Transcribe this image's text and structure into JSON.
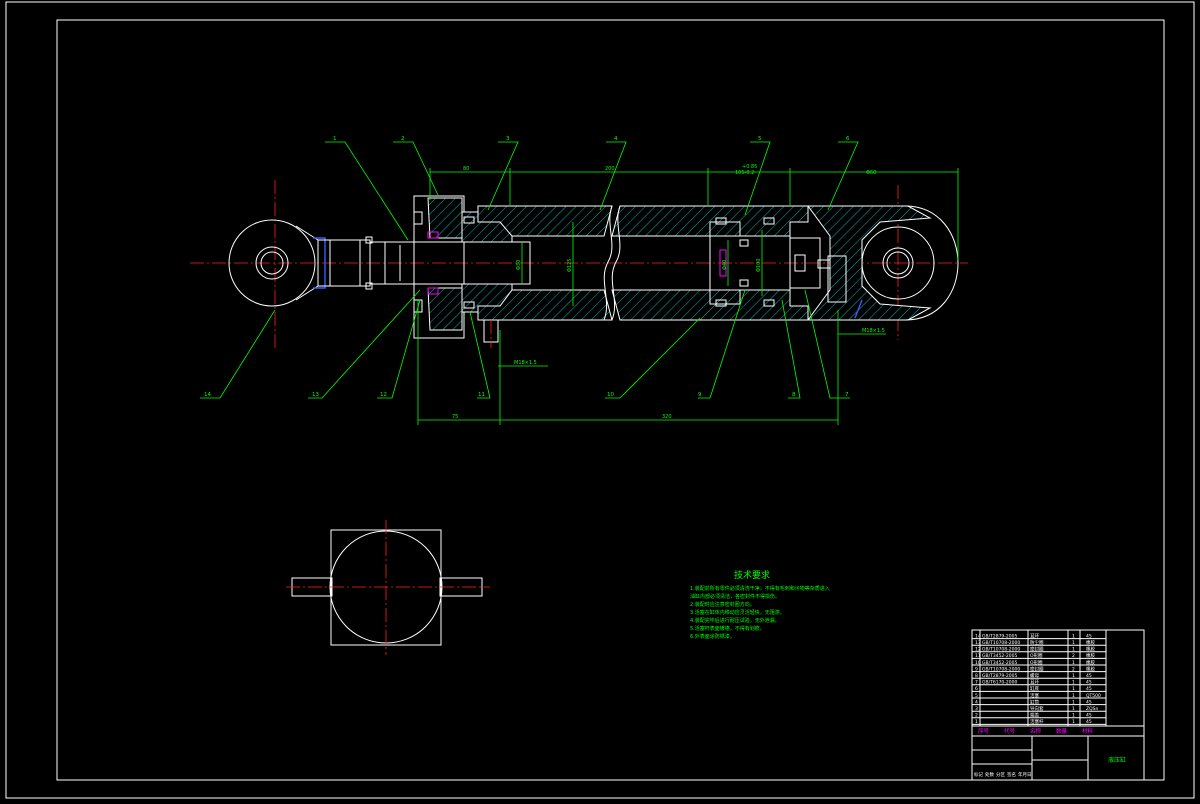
{
  "drawing": {
    "part_labels": [
      "1",
      "2",
      "3",
      "4",
      "5",
      "6",
      "7",
      "8",
      "9",
      "10",
      "11",
      "12",
      "13",
      "14"
    ],
    "dimensions": {
      "top_left": "80",
      "top_mid": "200",
      "top_small_a": "+0.85",
      "top_small_b": "105-0.2",
      "top_right": "Φ60",
      "bottom_left": "75",
      "bottom_right": "320",
      "port_left": "M18×1.5",
      "port_right": "M18×1.5",
      "dia_rod": "Φ30",
      "dia_bore": "Φ125",
      "dia_piston_a": "Φ40",
      "dia_piston_b": "Φ100"
    }
  },
  "tech_requirements": {
    "title": "技术要求",
    "items": [
      "1.装配前所有零件必须清洗干净，不得有毛刺和污物等杂质进入",
      "  油缸内部必须清洁，各密封件不得损伤。",
      "2.装配时应注意密封圈方向。",
      "3.活塞在缸体内移动应灵活轻快，无阻滞。",
      "4.装配完毕后进行耐压试验，无外泄漏。",
      "5.活塞杆表面镀铬，不得有划痕。",
      "6.外表面涂防锈漆。"
    ]
  },
  "title_block": {
    "drawing_name": "液压缸",
    "header_labels": [
      "标记",
      "处数",
      "分区",
      "签名",
      "年月日"
    ],
    "rows": [
      [
        "14",
        "GB/T2879-2005",
        "耳环",
        "1",
        "45"
      ],
      [
        "13",
        "GB/T10708-2000",
        "防尘圈",
        "1",
        "橡胶"
      ],
      [
        "12",
        "GB/T10708-2000",
        "密封圈",
        "1",
        "橡胶"
      ],
      [
        "11",
        "GB/T3452-2005",
        "O形圈",
        "2",
        "橡胶"
      ],
      [
        "10",
        "GB/T3452-2005",
        "O形圈",
        "1",
        "橡胶"
      ],
      [
        "9",
        "GB/T10708-2000",
        "密封圈",
        "2",
        "橡胶"
      ],
      [
        "8",
        "GB/T2879-2005",
        "螺母",
        "1",
        "45"
      ],
      [
        "7",
        "GB/T6170-2000",
        "耳环",
        "1",
        "45"
      ],
      [
        "6",
        "",
        "缸底",
        "1",
        "45"
      ],
      [
        "5",
        "",
        "活塞",
        "1",
        "QT500"
      ],
      [
        "4",
        "",
        "缸筒",
        "1",
        "45"
      ],
      [
        "3",
        "",
        "导向套",
        "1",
        "ZQSn"
      ],
      [
        "2",
        "",
        "端盖",
        "1",
        "45"
      ],
      [
        "1",
        "",
        "活塞杆",
        "1",
        "45"
      ]
    ],
    "footer_labels": [
      "序号",
      "代号",
      "名称",
      "数量",
      "材料"
    ]
  },
  "colors": {
    "background": "#000000",
    "outline": "#ffffff",
    "dimension": "#00ff00",
    "centerline": "#ff2020",
    "highlight": "#ff00ff",
    "seal": "#3a5bff"
  }
}
